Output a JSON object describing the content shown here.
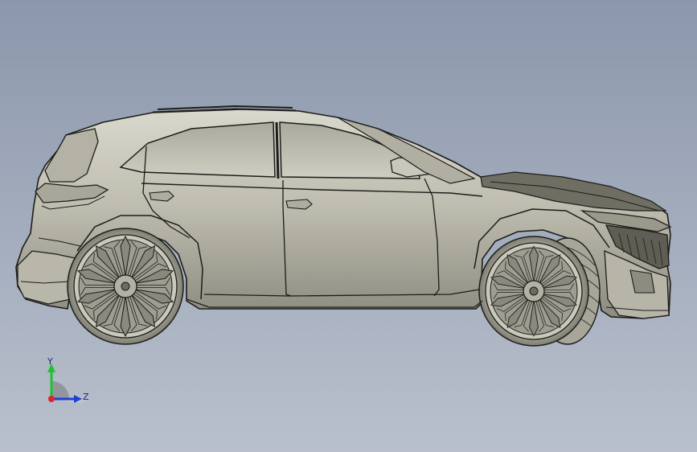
{
  "triad": {
    "y_label": "Y",
    "z_label": "Z",
    "y_color": "#21c230",
    "z_color": "#1f3fd6",
    "x_color": "#e0232a"
  },
  "model": {
    "icon": "hatchback-car-model",
    "body_color": "#c4c3b5",
    "edge_color": "#1d1d1a"
  }
}
